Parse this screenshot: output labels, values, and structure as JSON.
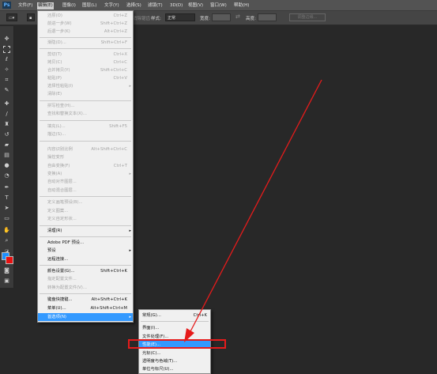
{
  "app": {
    "logo": "Ps"
  },
  "menubar": {
    "items": [
      {
        "label": "文件(F)"
      },
      {
        "label": "编辑(E)",
        "active": true
      },
      {
        "label": "图像(I)"
      },
      {
        "label": "图层(L)"
      },
      {
        "label": "文字(Y)"
      },
      {
        "label": "选择(S)"
      },
      {
        "label": "滤镜(T)"
      },
      {
        "label": "3D(D)"
      },
      {
        "label": "视图(V)"
      },
      {
        "label": "窗口(W)"
      },
      {
        "label": "帮助(H)"
      }
    ]
  },
  "optionsbar": {
    "antialias": "消除锯齿",
    "style_label": "样式:",
    "style_value": "正常",
    "width_label": "宽度:",
    "height_label": "高度:",
    "refine_edge": "调整边缘..."
  },
  "colors": {
    "foreground": "#1e90ff",
    "background": "#e81010",
    "menu_highlight": "#3399ff",
    "annotation": "#e61b1b"
  },
  "edit_menu": {
    "items": [
      {
        "label": "还原(O)",
        "shortcut": "Ctrl+Z",
        "enabled": false
      },
      {
        "label": "前进一步(W)",
        "shortcut": "Shift+Ctrl+Z",
        "enabled": false
      },
      {
        "label": "后退一步(K)",
        "shortcut": "Alt+Ctrl+Z",
        "enabled": false
      },
      {
        "label": "渐隐(D)...",
        "shortcut": "Shift+Ctrl+F",
        "enabled": false
      },
      {
        "label": "剪切(T)",
        "shortcut": "Ctrl+X",
        "enabled": false
      },
      {
        "label": "拷贝(C)",
        "shortcut": "Ctrl+C",
        "enabled": false
      },
      {
        "label": "合并拷贝(Y)",
        "shortcut": "Shift+Ctrl+C",
        "enabled": false
      },
      {
        "label": "粘贴(P)",
        "shortcut": "Ctrl+V",
        "enabled": false
      },
      {
        "label": "选择性粘贴(I)",
        "shortcut": "",
        "enabled": false,
        "submenu": true
      },
      {
        "label": "清除(E)",
        "shortcut": "",
        "enabled": false
      },
      {
        "label": "拼写检查(H)...",
        "shortcut": "",
        "enabled": false
      },
      {
        "label": "查找和替换文本(X)...",
        "shortcut": "",
        "enabled": false
      },
      {
        "label": "填充(L)...",
        "shortcut": "Shift+F5",
        "enabled": false
      },
      {
        "label": "描边(S)...",
        "shortcut": "",
        "enabled": false
      },
      {
        "label": "内容识别比例",
        "shortcut": "Alt+Shift+Ctrl+C",
        "enabled": false
      },
      {
        "label": "操控变形",
        "shortcut": "",
        "enabled": false
      },
      {
        "label": "自由变换(F)",
        "shortcut": "Ctrl+T",
        "enabled": false
      },
      {
        "label": "变换(A)",
        "shortcut": "",
        "enabled": false,
        "submenu": true
      },
      {
        "label": "自动对齐图层...",
        "shortcut": "",
        "enabled": false
      },
      {
        "label": "自动混合图层...",
        "shortcut": "",
        "enabled": false
      },
      {
        "label": "定义画笔预设(B)...",
        "shortcut": "",
        "enabled": false
      },
      {
        "label": "定义图案...",
        "shortcut": "",
        "enabled": false
      },
      {
        "label": "定义自定形状...",
        "shortcut": "",
        "enabled": false
      },
      {
        "label": "清理(R)",
        "shortcut": "",
        "enabled": true,
        "submenu": true
      },
      {
        "label": "Adobe PDF 预设...",
        "shortcut": "",
        "enabled": true
      },
      {
        "label": "预设",
        "shortcut": "",
        "enabled": true,
        "submenu": true
      },
      {
        "label": "远程连接...",
        "shortcut": "",
        "enabled": true
      },
      {
        "label": "颜色设置(G)...",
        "shortcut": "Shift+Ctrl+K",
        "enabled": true
      },
      {
        "label": "指定配置文件...",
        "shortcut": "",
        "enabled": false
      },
      {
        "label": "转换为配置文件(V)...",
        "shortcut": "",
        "enabled": false
      },
      {
        "label": "键盘快捷键...",
        "shortcut": "Alt+Shift+Ctrl+K",
        "enabled": true
      },
      {
        "label": "菜单(U)...",
        "shortcut": "Alt+Shift+Ctrl+M",
        "enabled": true
      },
      {
        "label": "首选项(N)",
        "shortcut": "",
        "enabled": true,
        "submenu": true,
        "selected": true
      }
    ]
  },
  "prefs_submenu": {
    "items": [
      {
        "label": "常规(G)...",
        "shortcut": "Ctrl+K"
      },
      {
        "label": "界面(I)..."
      },
      {
        "label": "文件处理(F)..."
      },
      {
        "label": "性能(E)...",
        "selected": true
      },
      {
        "label": "光标(C)..."
      },
      {
        "label": "透明度与色域(T)..."
      },
      {
        "label": "单位与标尺(U)..."
      }
    ]
  }
}
